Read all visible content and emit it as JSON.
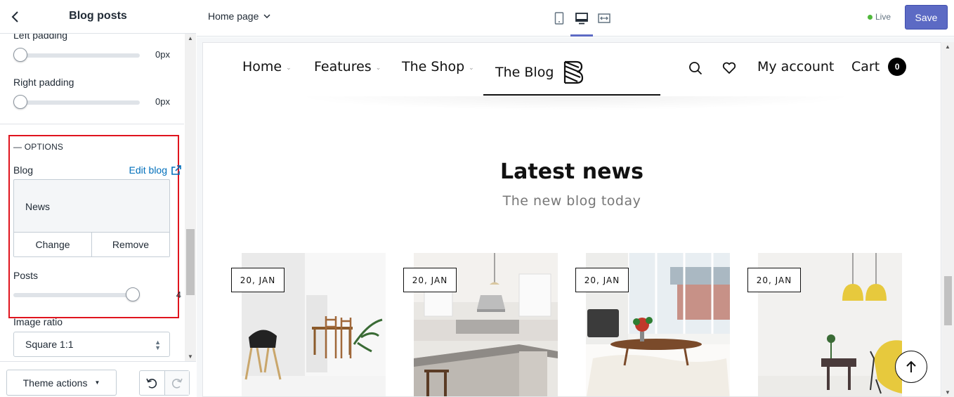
{
  "sidebar": {
    "title": "Blog posts",
    "left_padding_label": "Left padding",
    "left_padding_value": "0px",
    "right_padding_label": "Right padding",
    "right_padding_value": "0px",
    "options_heading": "— OPTIONS",
    "blog_label": "Blog",
    "edit_blog_label": "Edit blog",
    "blog_name": "News",
    "change_label": "Change",
    "remove_label": "Remove",
    "posts_label": "Posts",
    "posts_value": "4",
    "posts_fraction": 1.0,
    "image_ratio_label": "Image ratio",
    "image_ratio_value": "Square 1:1",
    "theme_actions_label": "Theme actions"
  },
  "topbar": {
    "page_select": "Home page",
    "live_label": "Live",
    "save_label": "Save",
    "accent_color": "#5c6ac4",
    "live_color": "#50b83c"
  },
  "preview": {
    "nav": {
      "home": "Home",
      "features": "Features",
      "shop": "The Shop",
      "blog": "The Blog",
      "account": "My account",
      "cart": "Cart",
      "cart_count": "0"
    },
    "section_title": "Latest news",
    "section_subtitle": "The new blog today",
    "posts": [
      {
        "date": "20, JAN",
        "image": "white-room-chair-icon"
      },
      {
        "date": "20, JAN",
        "image": "kitchen-icon"
      },
      {
        "date": "20, JAN",
        "image": "living-room-icon"
      },
      {
        "date": "20, JAN",
        "image": "yellow-lamps-icon"
      }
    ]
  },
  "highlight_color": "#e0141e"
}
